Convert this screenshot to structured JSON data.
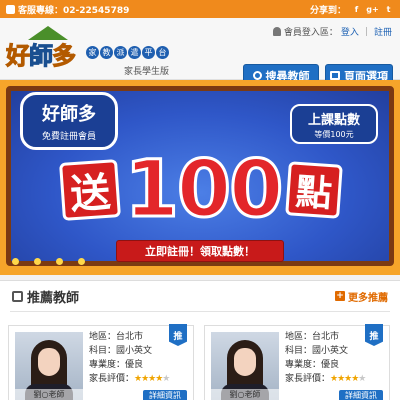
{
  "topbar": {
    "phone": "客服專線：02-22545789",
    "share_label": "分享到：",
    "social": [
      {
        "icon": "facebook-icon",
        "label": "f"
      },
      {
        "icon": "google-plus-icon",
        "label": "g+"
      },
      {
        "icon": "twitter-icon",
        "label": "t"
      }
    ],
    "accent": "#f08a1c"
  },
  "header": {
    "logo_text_1": "好",
    "logo_text_2": "師",
    "logo_text_3": "多",
    "logo_tags": [
      "家",
      "教",
      "派",
      "遣",
      "平",
      "台"
    ],
    "logo_sub": "家長學生版",
    "login_prefix": "會員登入區：",
    "login_link": "登入",
    "register_link": "註冊",
    "search_button": "搜尋教師",
    "menu_button": "頁面選項",
    "button_color": "#1f6fc4"
  },
  "banner": {
    "bubble_title": "好師多",
    "bubble_sub": "免費註冊會員",
    "points_title": "上課點數",
    "points_sub": "等價100元",
    "send": "送",
    "number": "100",
    "unit": "點",
    "cta": "立即註冊！領取點數！"
  },
  "recommend": {
    "title": "推薦教師",
    "more": "更多推薦",
    "cards": [
      {
        "badge": "推",
        "name": "劉○老師",
        "region": "地區：台北市",
        "subject": "科目：國小英文",
        "level": "專業度：優良",
        "rating_label": "家長評價：",
        "stars_on": "★★★★",
        "stars_off": "★",
        "detail": "詳細資訊"
      },
      {
        "badge": "推",
        "name": "劉○老師",
        "region": "地區：台北市",
        "subject": "科目：國小英文",
        "level": "專業度：優良",
        "rating_label": "家長評價：",
        "stars_on": "★★★★",
        "stars_off": "★",
        "detail": "詳細資訊"
      }
    ]
  }
}
